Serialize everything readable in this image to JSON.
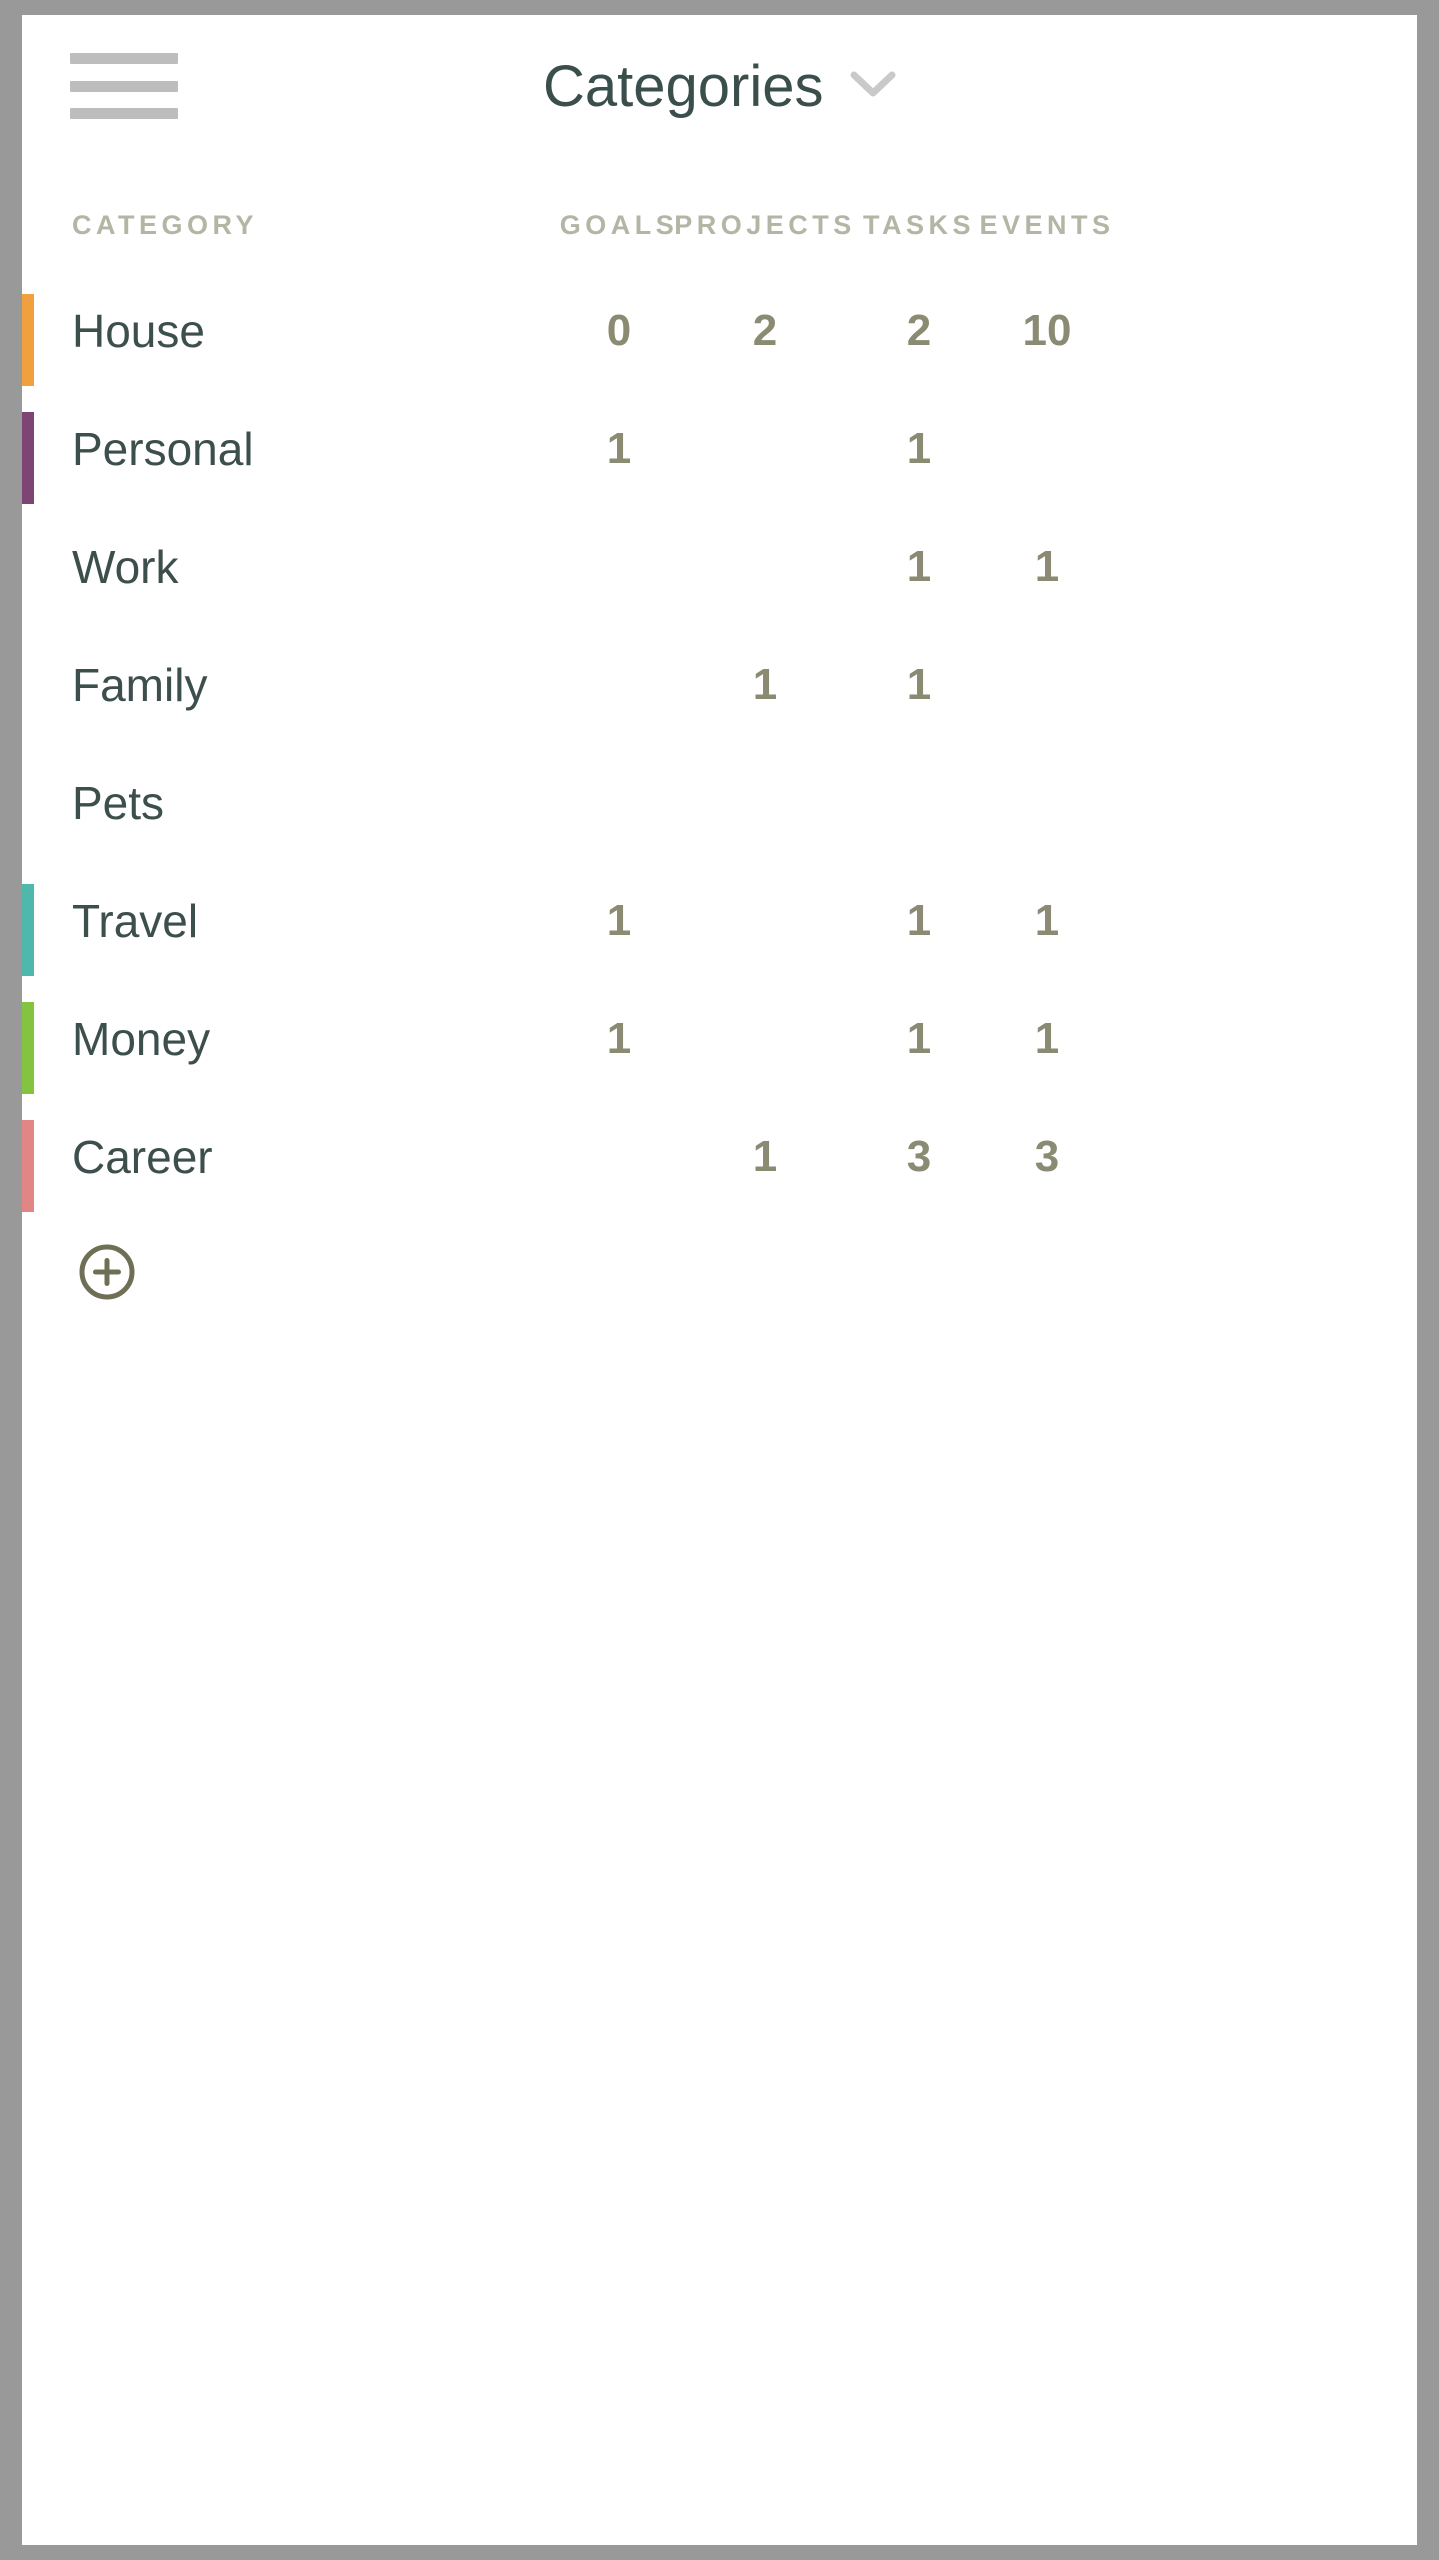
{
  "window": {
    "frame_color": "#999999",
    "card_background": "#ffffff"
  },
  "header": {
    "menu_icon": "hamburger-icon",
    "title": "Categories",
    "title_color": "#3a4f4b",
    "dropdown_icon": "chevron-down-icon",
    "dropdown_icon_color": "#c9c9c9"
  },
  "table": {
    "columns": [
      {
        "key": "category",
        "label": "CATEGORY"
      },
      {
        "key": "goals",
        "label": "GOALS"
      },
      {
        "key": "projects",
        "label": "PROJECTS"
      },
      {
        "key": "tasks",
        "label": "TASKS"
      },
      {
        "key": "events",
        "label": "EVENTS"
      }
    ],
    "header_color": "#b4b5a4",
    "name_color": "#3d4f4c",
    "value_color": "#8b8a72",
    "rows": [
      {
        "name": "House",
        "color": "#f0a03c",
        "goals": "0",
        "projects": "2",
        "tasks": "2",
        "events": "10"
      },
      {
        "name": "Personal",
        "color": "#7d4474",
        "goals": "1",
        "projects": "",
        "tasks": "1",
        "events": ""
      },
      {
        "name": "Work",
        "color": "",
        "goals": "",
        "projects": "",
        "tasks": "1",
        "events": "1"
      },
      {
        "name": "Family",
        "color": "",
        "goals": "",
        "projects": "1",
        "tasks": "1",
        "events": ""
      },
      {
        "name": "Pets",
        "color": "",
        "goals": "",
        "projects": "",
        "tasks": "",
        "events": ""
      },
      {
        "name": "Travel",
        "color": "#4fb8ad",
        "goals": "1",
        "projects": "",
        "tasks": "1",
        "events": "1"
      },
      {
        "name": "Money",
        "color": "#84c340",
        "goals": "1",
        "projects": "",
        "tasks": "1",
        "events": "1"
      },
      {
        "name": "Career",
        "color": "#e28585",
        "goals": "",
        "projects": "1",
        "tasks": "3",
        "events": "3"
      }
    ]
  },
  "actions": {
    "add_category_icon": "plus-circle-icon",
    "add_category_color": "#6f6f56"
  }
}
